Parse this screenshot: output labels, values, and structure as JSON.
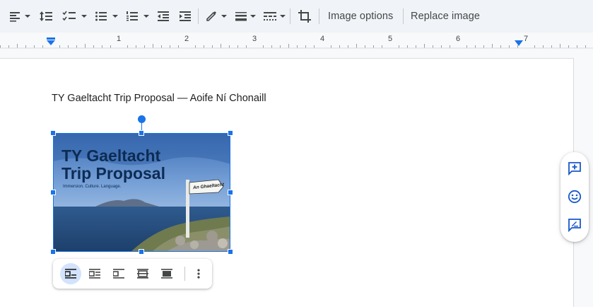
{
  "toolbar": {
    "image_options_label": "Image options",
    "replace_image_label": "Replace image"
  },
  "ruler": {
    "numbers": [
      "1",
      "2",
      "3",
      "4",
      "5",
      "6",
      "7"
    ]
  },
  "document": {
    "title_line": "TY Gaeltacht Trip Proposal — Aoife Ní Chonaill"
  },
  "image": {
    "heading_line1": "TY Gaeltacht",
    "heading_line2": "Trip Proposal",
    "tagline": "Immersion. Culture. Language.",
    "sign_text": "An Ghaeltacht"
  },
  "colors": {
    "accent": "#1a73e8",
    "toolbar_bg": "#f0f4f9",
    "active_chip": "#d3e3fd",
    "heading_navy": "#0d2c54"
  },
  "icons": {
    "side_panel": [
      "add-comment-icon",
      "emoji-reaction-icon",
      "suggest-edit-icon"
    ],
    "image_bar": [
      "wrap-inline-icon",
      "wrap-text-icon",
      "break-text-icon",
      "behind-text-icon",
      "in-front-of-text-icon",
      "more-vert-icon"
    ]
  }
}
